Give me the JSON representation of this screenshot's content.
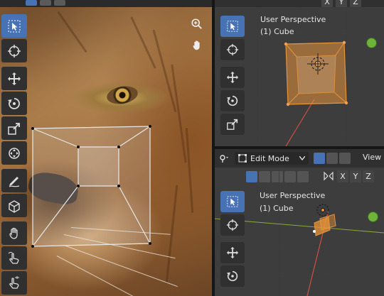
{
  "image_editor": {
    "toolbar": [
      "select-box",
      "cursor",
      "move",
      "rotate",
      "scale",
      "transform",
      "annotate",
      "add-cube",
      "grab",
      "tweak",
      "hand-scroll"
    ],
    "nav": [
      "zoom-in-icon",
      "pan-hand-icon"
    ]
  },
  "viewport_top": {
    "title": "User Perspective",
    "object": "(1) Cube",
    "axes": [
      "X",
      "Y",
      "Z"
    ]
  },
  "edit_header": {
    "mode": "Edit Mode",
    "view_menu": "View"
  },
  "viewport_bottom": {
    "axes": [
      "X",
      "Y",
      "Z"
    ],
    "title": "User Perspective",
    "object": "(1) Cube"
  },
  "colors": {
    "accent": "#4772b3",
    "cube_orange": "#e8943a",
    "gizmo_green": "#6fb43a",
    "viewport_bg": "#3d3d3d"
  }
}
